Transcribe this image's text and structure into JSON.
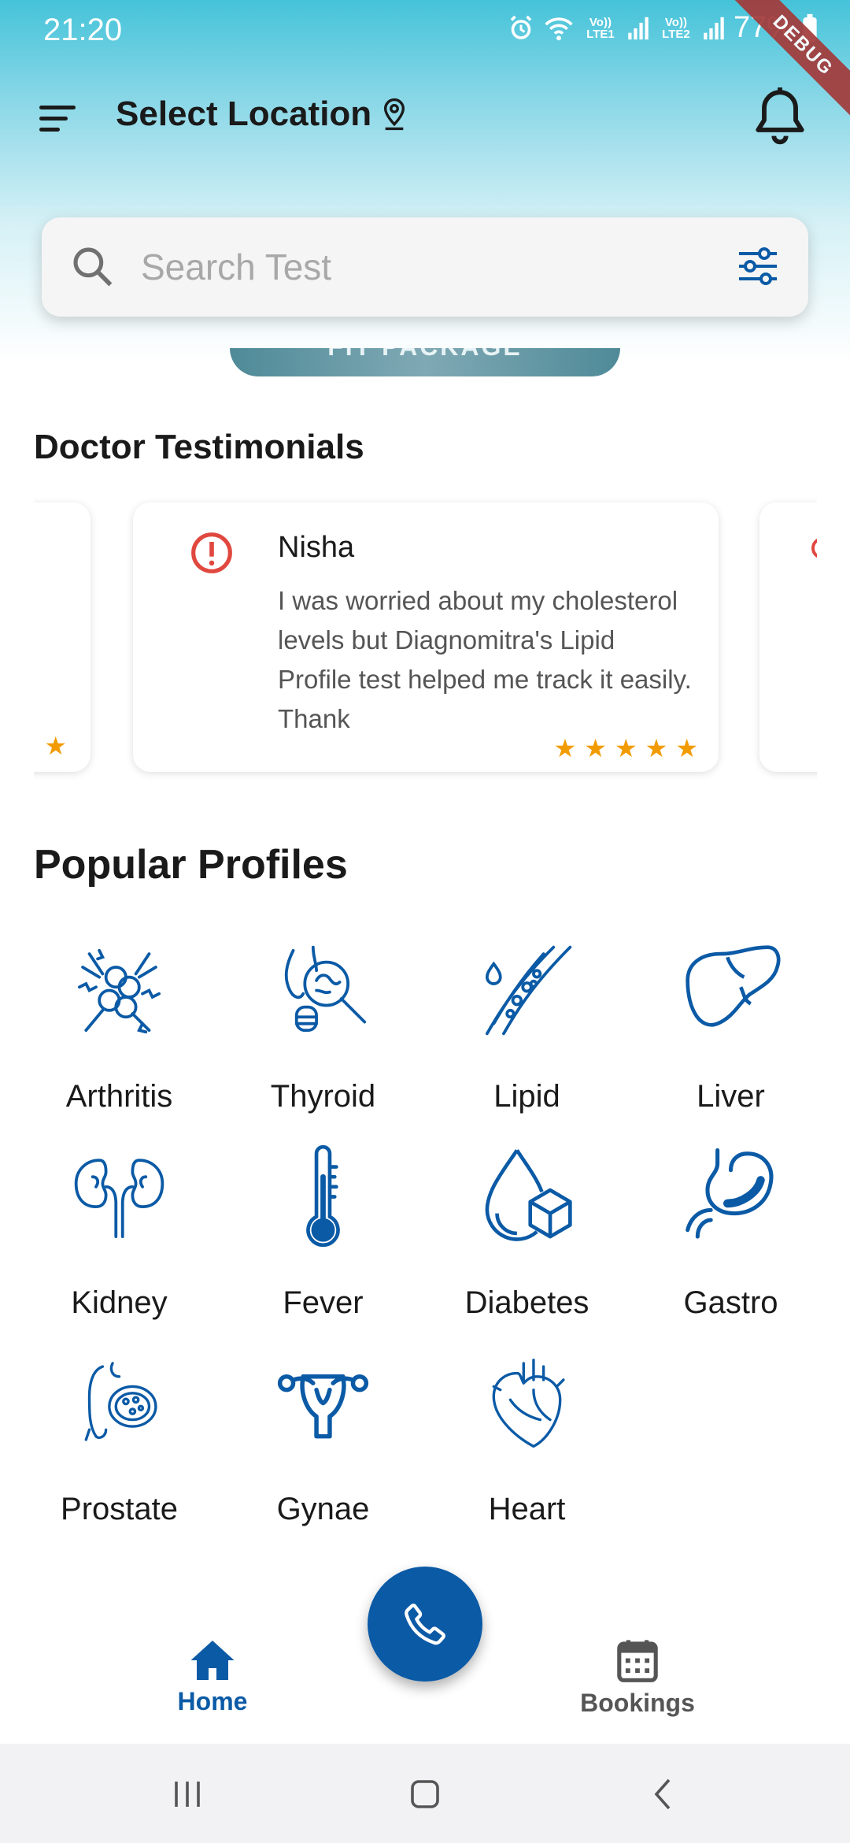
{
  "status_bar": {
    "time": "21:20",
    "network_1": "Vo)) LTE1",
    "network_2": "Vo)) LTE2",
    "battery": "77%",
    "debug_banner": "DEBUG"
  },
  "header": {
    "location_label": "Select Location",
    "icons": [
      "menu-icon",
      "location-pin-icon",
      "bell-icon"
    ]
  },
  "search": {
    "placeholder": "Search Test",
    "value": "",
    "icons": [
      "search-icon",
      "filter-icon"
    ]
  },
  "package_banner": {
    "label": "FIT PACKAGE"
  },
  "testimonials": {
    "title": "Doctor Testimonials",
    "items": [
      {
        "name": "Nisha",
        "text": "I was worried about my cholesterol levels but Diagnomitra's Lipid Profile test helped me track it easily. Thank",
        "rating": 5
      }
    ]
  },
  "profiles": {
    "title": "Popular Profiles",
    "items": [
      {
        "label": "Arthritis",
        "icon": "arthritis-icon"
      },
      {
        "label": "Thyroid",
        "icon": "thyroid-icon"
      },
      {
        "label": "Lipid",
        "icon": "lipid-icon"
      },
      {
        "label": "Liver",
        "icon": "liver-icon"
      },
      {
        "label": "Kidney",
        "icon": "kidney-icon"
      },
      {
        "label": "Fever",
        "icon": "thermometer-icon"
      },
      {
        "label": "Diabetes",
        "icon": "diabetes-icon"
      },
      {
        "label": "Gastro",
        "icon": "stomach-icon"
      },
      {
        "label": "Prostate",
        "icon": "prostate-icon"
      },
      {
        "label": "Gynae",
        "icon": "uterus-icon"
      },
      {
        "label": "Heart",
        "icon": "heart-icon"
      }
    ]
  },
  "bottom_nav": {
    "home_label": "Home",
    "bookings_label": "Bookings",
    "fab_icon": "phone-icon"
  },
  "colors": {
    "primary": "#0b5aa6",
    "header_top": "#45c3d9",
    "star": "#f29b00",
    "alert": "#e0483f"
  }
}
